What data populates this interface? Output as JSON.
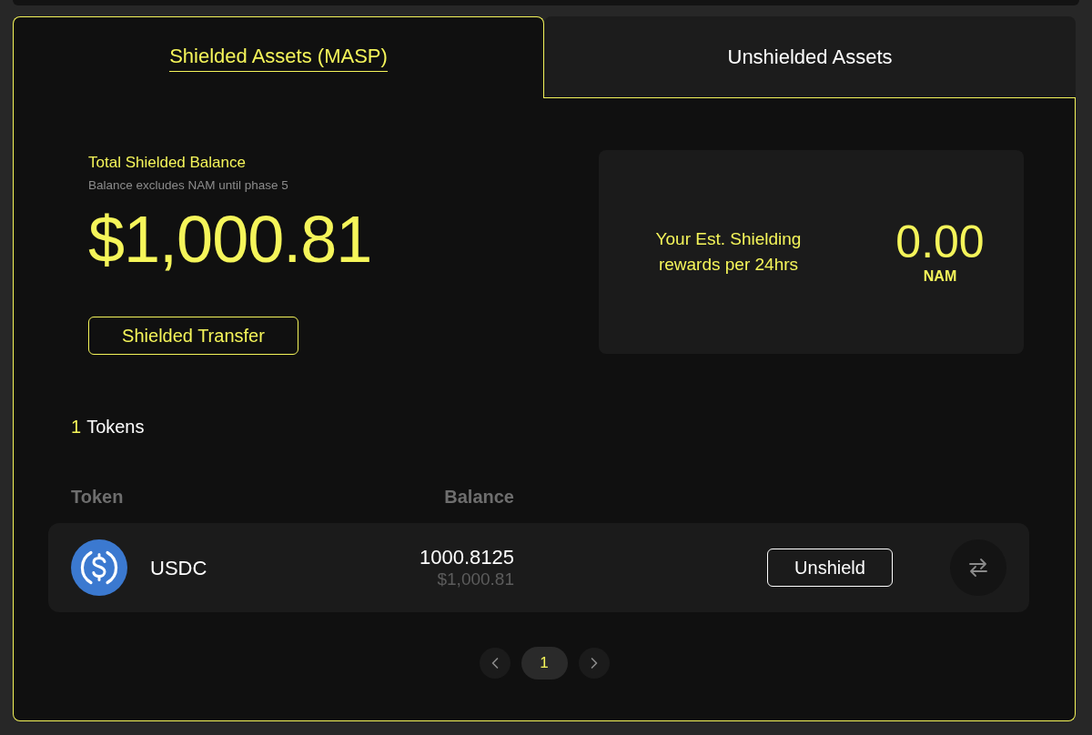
{
  "tabs": [
    {
      "label": "Shielded Assets (MASP)",
      "selected": true
    },
    {
      "label": "Unshielded Assets",
      "selected": false
    }
  ],
  "balance": {
    "title": "Total Shielded Balance",
    "note": "Balance excludes NAM until phase 5",
    "amount": "$1,000.81",
    "button": "Shielded Transfer"
  },
  "rewards": {
    "label": "Your Est. Shielding rewards per 24hrs",
    "value": "0.00",
    "unit": "NAM"
  },
  "tokens": {
    "count": "1",
    "label": "Tokens"
  },
  "table": {
    "columns": [
      "Token",
      "Balance"
    ],
    "rows": [
      {
        "token": "USDC",
        "amount": "1000.8125",
        "value": "$1,000.81",
        "action": "Unshield"
      }
    ]
  },
  "pagination": {
    "pages": [
      {
        "label": "1",
        "selected": true
      }
    ]
  }
}
